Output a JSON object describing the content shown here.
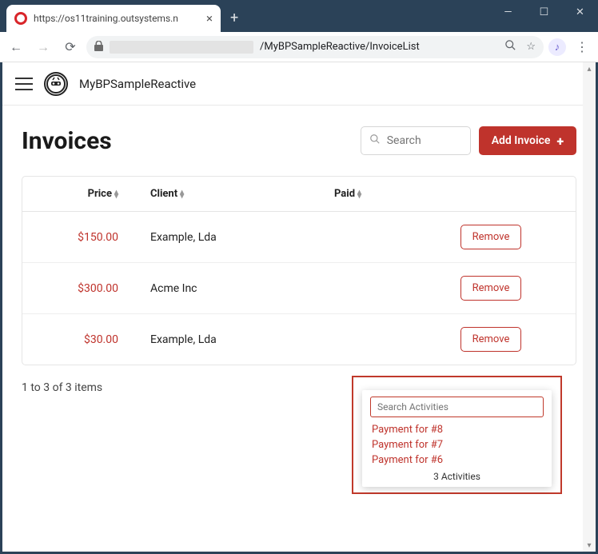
{
  "window": {
    "tab_title": "https://os11training.outsystems.n",
    "url_path": "/MyBPSampleReactive/InvoiceList"
  },
  "app": {
    "name": "MyBPSampleReactive"
  },
  "page": {
    "title": "Invoices",
    "search_placeholder": "Search",
    "add_label": "Add Invoice"
  },
  "table": {
    "headers": {
      "price": "Price",
      "client": "Client",
      "paid": "Paid"
    },
    "rows": [
      {
        "price": "$150.00",
        "client": "Example, Lda",
        "remove": "Remove"
      },
      {
        "price": "$300.00",
        "client": "Acme Inc",
        "remove": "Remove"
      },
      {
        "price": "$30.00",
        "client": "Example, Lda",
        "remove": "Remove"
      }
    ]
  },
  "pagination": "1 to 3 of 3 items",
  "taskbox": {
    "placeholder": "Search Activities",
    "items": [
      "Payment for #8",
      "Payment for #7",
      "Payment for #6"
    ],
    "count": "3 Activities"
  }
}
